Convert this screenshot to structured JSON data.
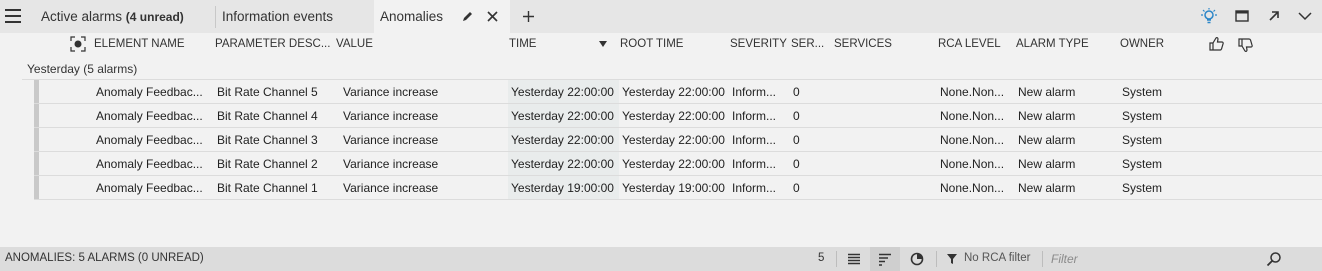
{
  "tabs": [
    {
      "label": "Active alarms",
      "badge": "(4 unread)"
    },
    {
      "label": "Information events"
    },
    {
      "label": "Anomalies"
    }
  ],
  "columns": [
    "ELEMENT NAME",
    "PARAMETER DESC...",
    "VALUE",
    "TIME",
    "ROOT TIME",
    "SEVERITY",
    "SER...",
    "SERVICES",
    "RCA LEVEL",
    "ALARM TYPE",
    "OWNER"
  ],
  "group": {
    "label": "Yesterday (5 alarms)"
  },
  "rows": [
    {
      "element": "Anomaly Feedbac...",
      "parameter": "Bit Rate Channel 5",
      "value": "Variance increase",
      "time": "Yesterday 22:00:00",
      "root_time": "Yesterday 22:00:00",
      "severity": "Inform...",
      "ser": "0",
      "rca_level": "None.Non...",
      "alarm_type": "New alarm",
      "owner": "System"
    },
    {
      "element": "Anomaly Feedbac...",
      "parameter": "Bit Rate Channel 4",
      "value": "Variance increase",
      "time": "Yesterday 22:00:00",
      "root_time": "Yesterday 22:00:00",
      "severity": "Inform...",
      "ser": "0",
      "rca_level": "None.Non...",
      "alarm_type": "New alarm",
      "owner": "System"
    },
    {
      "element": "Anomaly Feedbac...",
      "parameter": "Bit Rate Channel 3",
      "value": "Variance increase",
      "time": "Yesterday 22:00:00",
      "root_time": "Yesterday 22:00:00",
      "severity": "Inform...",
      "ser": "0",
      "rca_level": "None.Non...",
      "alarm_type": "New alarm",
      "owner": "System"
    },
    {
      "element": "Anomaly Feedbac...",
      "parameter": "Bit Rate Channel 2",
      "value": "Variance increase",
      "time": "Yesterday 22:00:00",
      "root_time": "Yesterday 22:00:00",
      "severity": "Inform...",
      "ser": "0",
      "rca_level": "None.Non...",
      "alarm_type": "New alarm",
      "owner": "System"
    },
    {
      "element": "Anomaly Feedbac...",
      "parameter": "Bit Rate Channel 1",
      "value": "Variance increase",
      "time": "Yesterday 19:00:00",
      "root_time": "Yesterday 19:00:00",
      "severity": "Inform...",
      "ser": "0",
      "rca_level": "None.Non...",
      "alarm_type": "New alarm",
      "owner": "System"
    }
  ],
  "status": {
    "summary": "ANOMALIES: 5 ALARMS (0 UNREAD)",
    "count": "5",
    "rca_filter": "No RCA filter",
    "filter_placeholder": "Filter"
  },
  "colors": {
    "accent": "#2b86c8",
    "selected_tab": "#f2f2f2",
    "tabbar": "#e6e6e6"
  }
}
